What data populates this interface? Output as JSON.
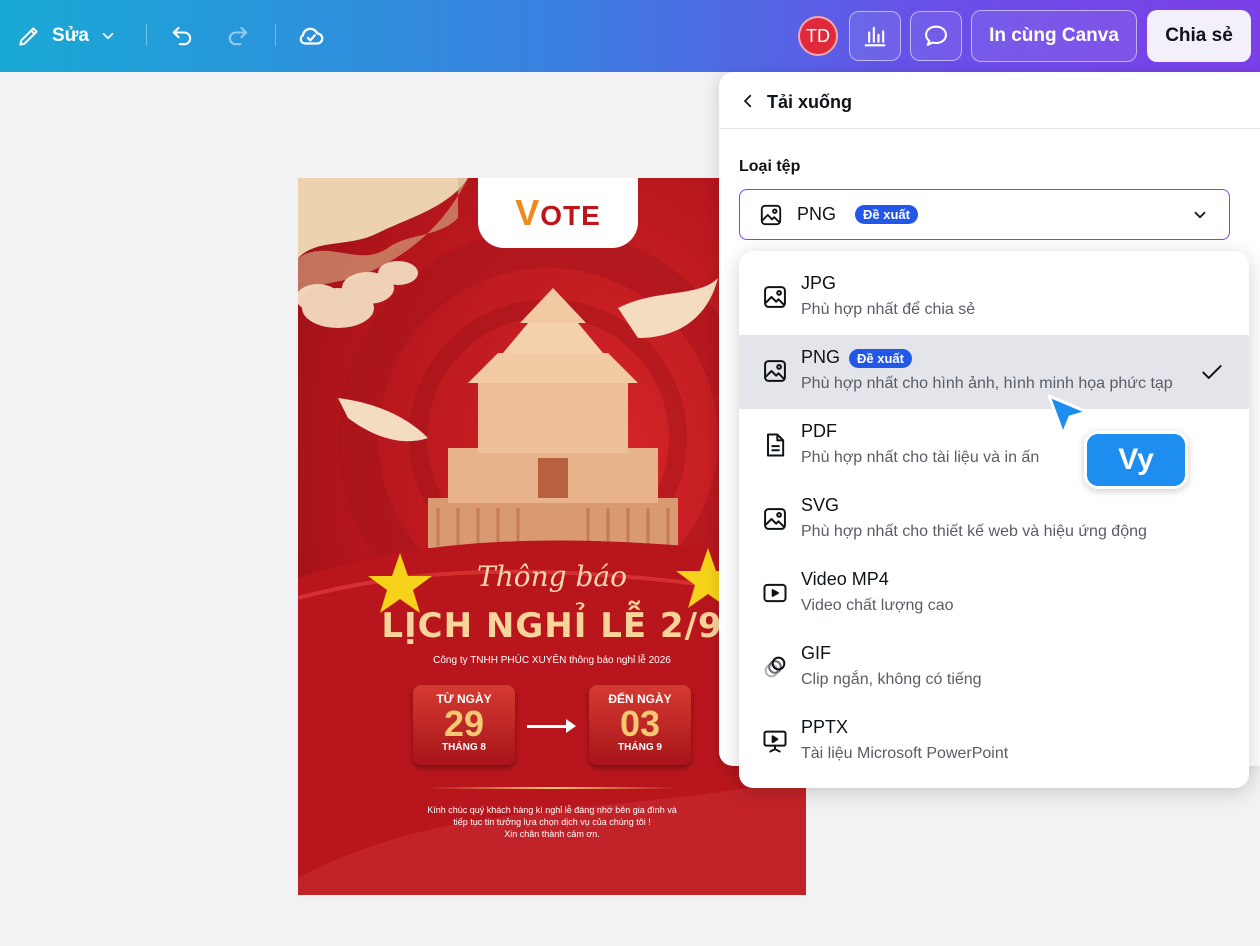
{
  "toolbar": {
    "edit_label": "Sửa",
    "avatar_initials": "TD",
    "print_label": "In cùng Canva",
    "share_label": "Chia sẻ"
  },
  "poster": {
    "logo_text": "OTE",
    "logo_letter": "V",
    "script_text": "Thông báo",
    "title": "LỊCH NGHỈ LỄ 2/9",
    "company_line": "Công ty TNHH PHÚC XUYÊN thông báo nghỉ lễ 2026",
    "from": {
      "label": "TỪ NGÀY",
      "day": "29",
      "month": "THÁNG 8"
    },
    "to": {
      "label": "ĐẾN NGÀY",
      "day": "03",
      "month": "THÁNG 9"
    },
    "footer_line1": "Kính chúc quý khách hàng kì nghỉ lễ đáng nhớ bên gia đình và",
    "footer_line2": "tiếp tục tin tưởng lựa chọn dịch vụ của chúng tôi !",
    "footer_line3": "Xin chân thành cảm ơn."
  },
  "panel": {
    "title": "Tải xuống",
    "file_type_label": "Loại tệp",
    "selected_value": "PNG",
    "selected_badge": "Đề xuất"
  },
  "options": [
    {
      "name": "JPG",
      "desc": "Phù hợp nhất để chia sẻ",
      "icon": "image-icon"
    },
    {
      "name": "PNG",
      "badge": "Đề xuất",
      "desc": "Phù hợp nhất cho hình ảnh, hình minh họa phức tạp",
      "icon": "image-icon",
      "selected": true
    },
    {
      "name": "PDF",
      "desc": "Phù hợp nhất cho tài liệu và in ấn",
      "icon": "document-icon"
    },
    {
      "name": "SVG",
      "desc": "Phù hợp nhất cho thiết kế web và hiệu ứng động",
      "icon": "image-icon"
    },
    {
      "name": "Video MP4",
      "desc": "Video chất lượng cao",
      "icon": "video-icon"
    },
    {
      "name": "GIF",
      "desc": "Clip ngắn, không có tiếng",
      "icon": "gif-icon"
    },
    {
      "name": "PPTX",
      "desc": "Tài liệu Microsoft PowerPoint",
      "icon": "presentation-icon"
    }
  ],
  "cursor": {
    "user_name": "Vy"
  },
  "colors": {
    "accent": "#8b3dff",
    "badge": "#2257e8",
    "cursor": "#1d8ef0",
    "poster_red": "#b5161c"
  }
}
